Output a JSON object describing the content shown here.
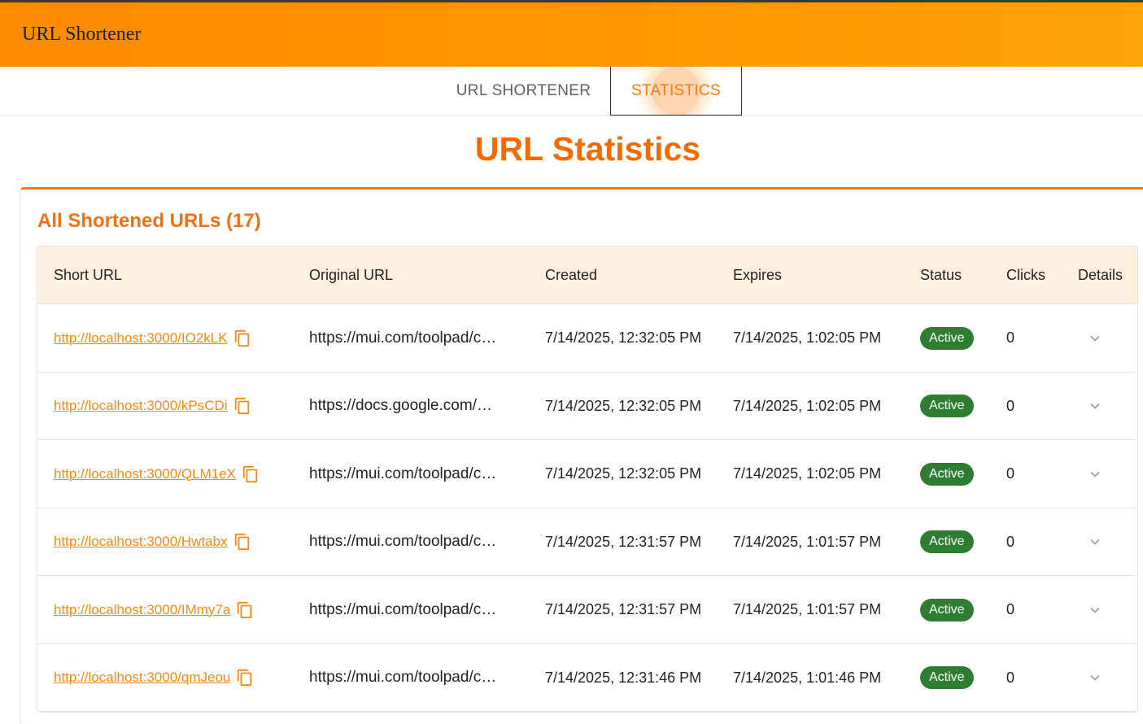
{
  "app": {
    "title": "URL Shortener"
  },
  "tabs": [
    {
      "label": "URL SHORTENER",
      "active": false
    },
    {
      "label": "STATISTICS",
      "active": true
    }
  ],
  "page": {
    "title": "URL Statistics"
  },
  "card": {
    "title": "All Shortened URLs (17)"
  },
  "table": {
    "headers": {
      "short_url": "Short URL",
      "original_url": "Original URL",
      "created": "Created",
      "expires": "Expires",
      "status": "Status",
      "clicks": "Clicks",
      "details": "Details"
    },
    "rows": [
      {
        "short_url": "http://localhost:3000/IO2kLK",
        "original_url": "https://mui.com/toolpad/c…",
        "created": "7/14/2025, 12:32:05 PM",
        "expires": "7/14/2025, 1:02:05 PM",
        "status": "Active",
        "clicks": "0"
      },
      {
        "short_url": "http://localhost:3000/kPsCDi",
        "original_url": "https://docs.google.com/…",
        "created": "7/14/2025, 12:32:05 PM",
        "expires": "7/14/2025, 1:02:05 PM",
        "status": "Active",
        "clicks": "0"
      },
      {
        "short_url": "http://localhost:3000/QLM1eX",
        "original_url": "https://mui.com/toolpad/c…",
        "created": "7/14/2025, 12:32:05 PM",
        "expires": "7/14/2025, 1:02:05 PM",
        "status": "Active",
        "clicks": "0"
      },
      {
        "short_url": "http://localhost:3000/Hwtabx",
        "original_url": "https://mui.com/toolpad/c…",
        "created": "7/14/2025, 12:31:57 PM",
        "expires": "7/14/2025, 1:01:57 PM",
        "status": "Active",
        "clicks": "0"
      },
      {
        "short_url": "http://localhost:3000/IMmy7a",
        "original_url": "https://mui.com/toolpad/c…",
        "created": "7/14/2025, 12:31:57 PM",
        "expires": "7/14/2025, 1:01:57 PM",
        "status": "Active",
        "clicks": "0"
      },
      {
        "short_url": "http://localhost:3000/qmJeou",
        "original_url": "https://mui.com/toolpad/c…",
        "created": "7/14/2025, 12:31:46 PM",
        "expires": "7/14/2025, 1:01:46 PM",
        "status": "Active",
        "clicks": "0"
      }
    ]
  },
  "icons": {
    "copy": "content-copy-icon",
    "details": "chevron-down-icon"
  },
  "colors": {
    "accent": "#ff8a00",
    "title": "#f26b00",
    "link": "#f08a12",
    "status_active": "#2e7d32",
    "header_bg": "#fff1dd"
  }
}
